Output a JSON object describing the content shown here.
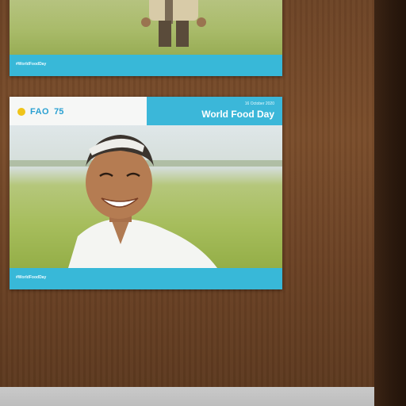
{
  "scene": {
    "description_free": true
  },
  "poster_top": {
    "footer_left": "#WorldFoodDay",
    "footer_right": ""
  },
  "poster_main": {
    "logo": {
      "org": "FAO",
      "anniversary": "75"
    },
    "title_band": {
      "date": "16 October 2020",
      "title": "World Food Day"
    },
    "body_text_1": "",
    "body_text_2": "",
    "footer_left": "#WorldFoodDay",
    "footer_right": ""
  },
  "colors": {
    "poster_accent": "#38b8d8",
    "wall": "#6d4426",
    "field": "#a6bd5c"
  }
}
